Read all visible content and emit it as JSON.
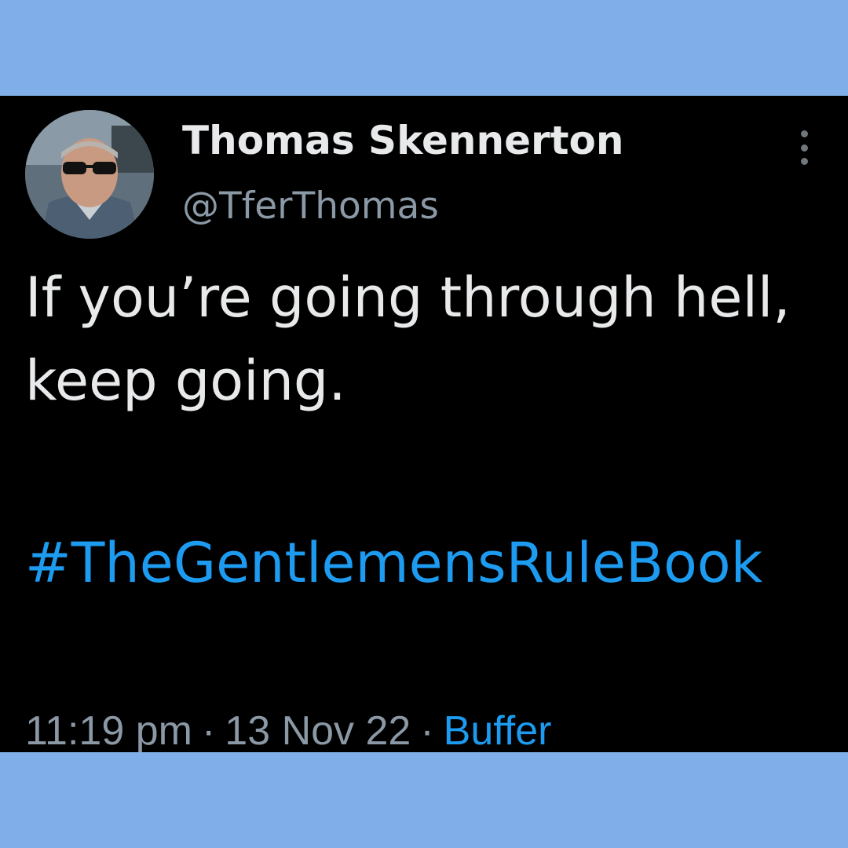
{
  "colors": {
    "background_band": "#80aee9",
    "card": "#000000",
    "name_text": "#e7e9ea",
    "secondary_text": "#8b98a5",
    "link": "#1d9bf0"
  },
  "author": {
    "display_name": "Thomas Skennerton",
    "handle": "@TferThomas",
    "avatar_icon": "profile-photo"
  },
  "tweet": {
    "text": "If you’re going through hell, keep going.",
    "hashtag": "#TheGentlemensRuleBook"
  },
  "meta": {
    "time": "11:19 pm",
    "separator": "·",
    "date": "13 Nov 22",
    "source": "Buffer"
  },
  "icons": {
    "menu": "more-vertical-icon"
  }
}
